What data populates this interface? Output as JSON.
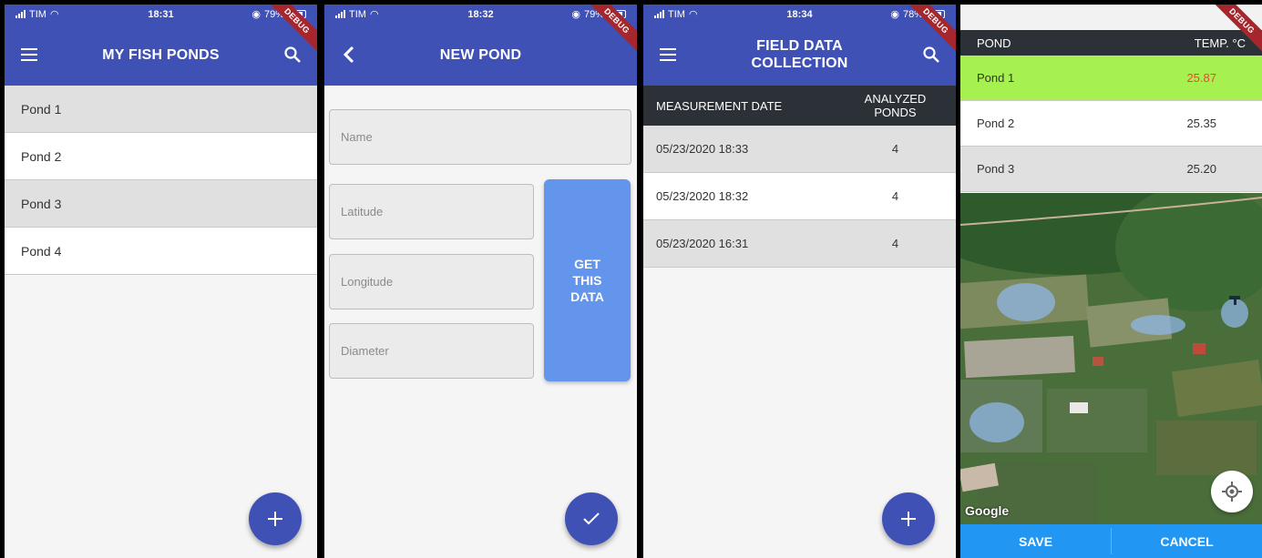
{
  "status_bars": [
    {
      "carrier": "TIM",
      "time": "18:31",
      "battery": "79%"
    },
    {
      "carrier": "TIM",
      "time": "18:32",
      "battery": "79%"
    },
    {
      "carrier": "TIM",
      "time": "18:34",
      "battery": "78%"
    }
  ],
  "debug_banner": "DEBUG",
  "screen1": {
    "title": "MY FISH PONDS",
    "ponds": [
      "Pond 1",
      "Pond 2",
      "Pond 3",
      "Pond 4"
    ],
    "fab_icon": "plus-icon"
  },
  "screen2": {
    "title": "NEW POND",
    "fields": {
      "name": "Name",
      "latitude": "Latitude",
      "longitude": "Longitude",
      "diameter": "Diameter"
    },
    "get_button_lines": [
      "GET",
      "THIS",
      "DATA"
    ],
    "fab_icon": "check-icon"
  },
  "screen3": {
    "title_line1": "FIELD DATA",
    "title_line2": "COLLECTION",
    "header_date": "MEASUREMENT DATE",
    "header_count_line1": "ANALYZED",
    "header_count_line2": "PONDS",
    "rows": [
      {
        "date": "05/23/2020 18:33",
        "count": "4"
      },
      {
        "date": "05/23/2020 18:32",
        "count": "4"
      },
      {
        "date": "05/23/2020 16:31",
        "count": "4"
      }
    ],
    "fab_icon": "plus-icon"
  },
  "screen4": {
    "header_pond": "POND",
    "header_temp": "TEMP. °C",
    "rows": [
      {
        "pond": "Pond 1",
        "temp": "25.87"
      },
      {
        "pond": "Pond 2",
        "temp": "25.35"
      },
      {
        "pond": "Pond 3",
        "temp": "25.20"
      }
    ],
    "map_attribution": "Google",
    "save_label": "SAVE",
    "cancel_label": "CANCEL"
  },
  "colors": {
    "primary": "#3f51b5",
    "get_button": "#6495ed",
    "table_header": "#2b3137",
    "highlight_row": "#a6f04f",
    "highlight_temp": "#f44336",
    "bottom_bar": "#2196f3",
    "debug_banner": "#a5262c"
  }
}
